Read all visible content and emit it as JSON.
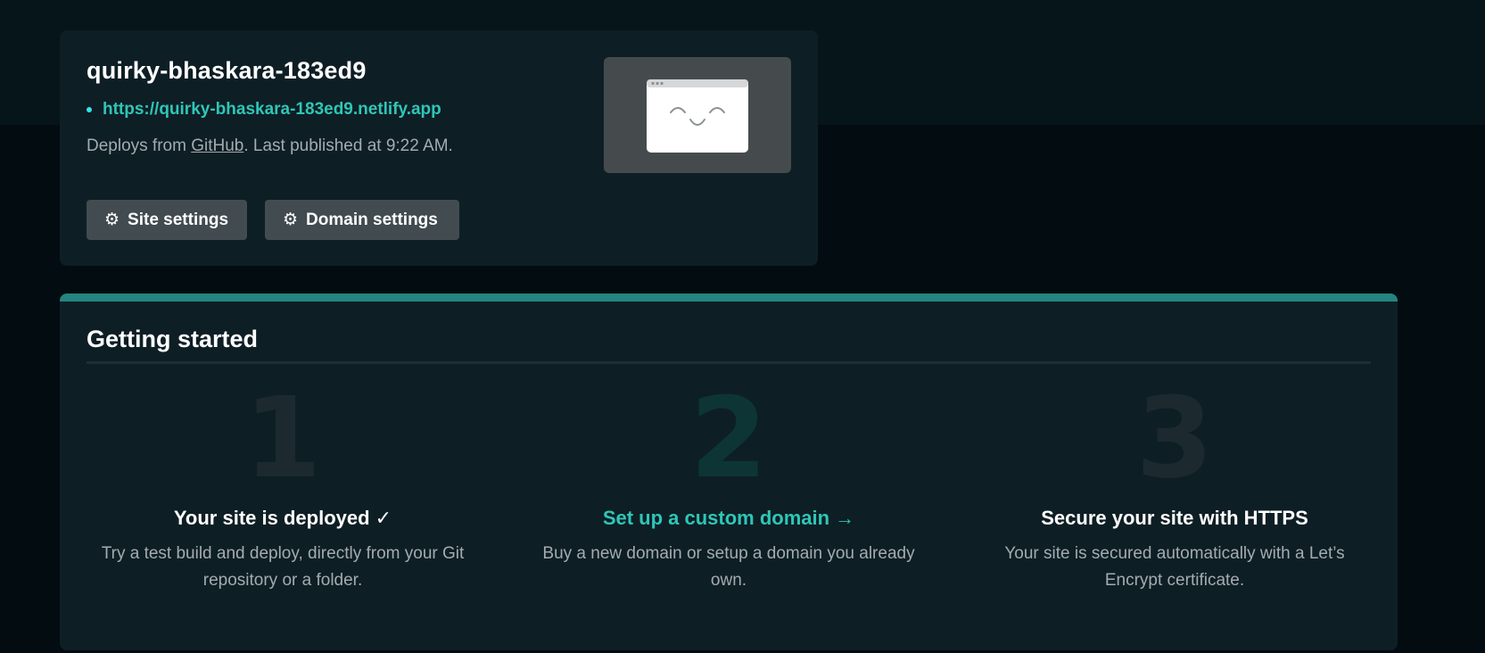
{
  "site": {
    "name": "quirky-bhaskara-183ed9",
    "url": "https://quirky-bhaskara-183ed9.netlify.app",
    "deploy_prefix": "Deploys from ",
    "deploy_source": "GitHub",
    "deploy_suffix": ". Last published at 9:22 AM.",
    "buttons": {
      "site_settings": "Site settings",
      "domain_settings": "Domain settings"
    },
    "icons": {
      "button_icon": "gear-icon",
      "preview": "smiling-browser-window"
    }
  },
  "getting_started": {
    "title": "Getting started",
    "steps": [
      {
        "number": "1",
        "heading": "Your site is deployed ✓",
        "description": "Try a test build and deploy, directly from your Git repository or a folder."
      },
      {
        "number": "2",
        "heading": "Set up a custom domain →",
        "description": "Buy a new domain or setup a domain you already own."
      },
      {
        "number": "3",
        "heading": "Secure your site with HTTPS",
        "description": "Your site is secured automatically with a Let’s Encrypt certificate."
      }
    ]
  },
  "colors": {
    "background": "#030c10",
    "card": "#0e1e25",
    "accent": "#2fc6b7",
    "accent_bar": "#24857e",
    "button": "#414b50"
  }
}
